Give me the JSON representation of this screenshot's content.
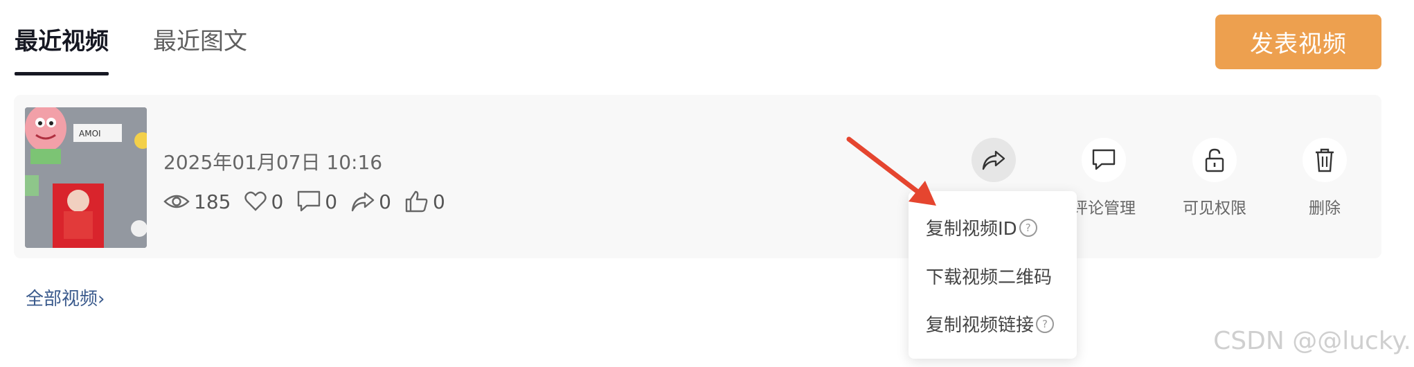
{
  "tabs": [
    {
      "label": "最近视频",
      "active": true
    },
    {
      "label": "最近图文",
      "active": false
    }
  ],
  "publish_button": {
    "label": "发表视频",
    "color": "#eda04f"
  },
  "video": {
    "datetime": "2025年01月07日 10:16",
    "stats": {
      "views": "185",
      "likes": "0",
      "comments": "0",
      "shares": "0",
      "thumbs_up": "0"
    }
  },
  "actions": [
    {
      "icon": "share-icon",
      "label": ""
    },
    {
      "icon": "comment-icon",
      "label": "评论管理"
    },
    {
      "icon": "lock-icon",
      "label": "可见权限"
    },
    {
      "icon": "trash-icon",
      "label": "删除"
    }
  ],
  "share_menu": {
    "items": [
      {
        "label": "复制视频ID",
        "help": "?"
      },
      {
        "label": "下载视频二维码"
      },
      {
        "label": "复制视频链接",
        "help": "?"
      }
    ]
  },
  "all_videos_link": "全部视频",
  "all_videos_chevron": "›",
  "watermark": "CSDN @@lucky.",
  "colors": {
    "accent": "#eda04f",
    "link": "#3a5a8c",
    "arrow": "#e5452f"
  }
}
